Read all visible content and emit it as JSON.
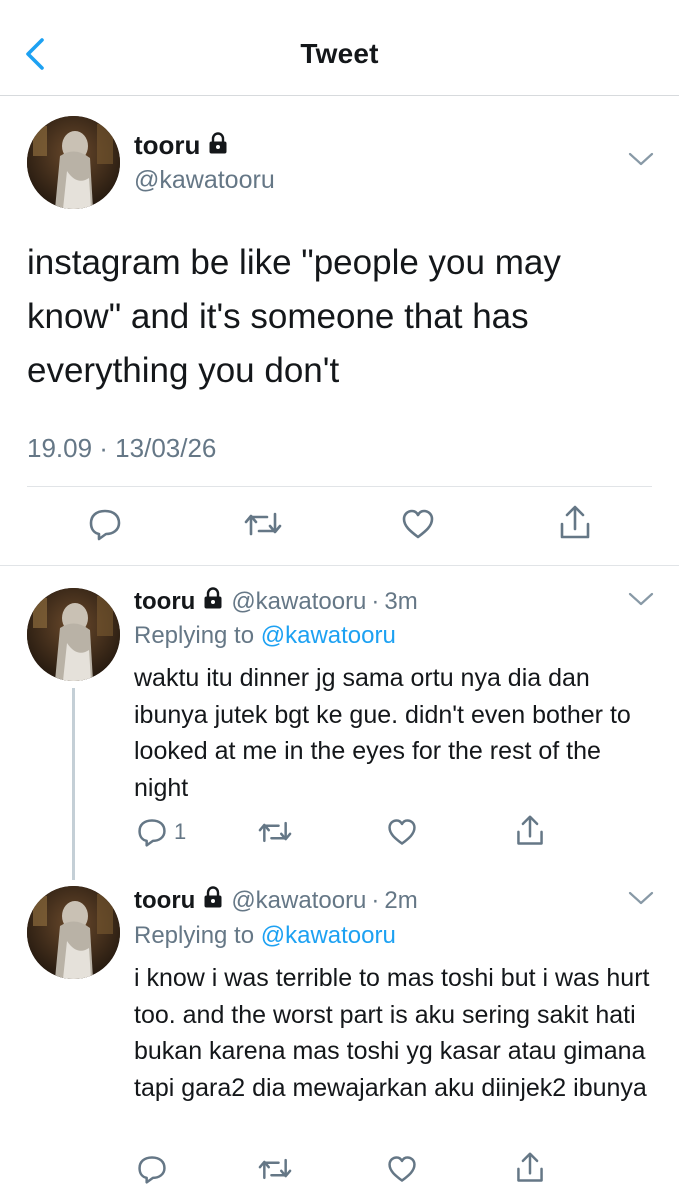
{
  "nav": {
    "title": "Tweet"
  },
  "main_tweet": {
    "name": "tooru",
    "handle": "@kawatooru",
    "text": "instagram be like \"people you may know\" and it's someone that has everything you don't",
    "timestamp": "19.09 · 13/03/26"
  },
  "replies": [
    {
      "name": "tooru",
      "handle": "@kawatooru",
      "sep": "·",
      "time": "3m",
      "replying_label": "Replying to",
      "replying_to": "@kawatooru",
      "text": "waktu itu dinner jg sama ortu nya dia dan ibunya jutek bgt ke gue. didn't even bother to looked at me in the eyes for the rest of the night",
      "reply_count": "1"
    },
    {
      "name": "tooru",
      "handle": "@kawatooru",
      "sep": "·",
      "time": "2m",
      "replying_label": "Replying to",
      "replying_to": "@kawatooru",
      "text": "i know i was terrible to mas toshi but i was hurt too. and the worst part is aku sering sakit hati bukan karena mas toshi yg kasar atau gimana tapi gara2 dia mewajarkan aku diinjek2 ibunya",
      "reply_count": ""
    }
  ],
  "colors": {
    "accent": "#1da1f2",
    "secondary_text": "#657786",
    "icon": "#657786"
  },
  "icons": [
    "back-chevron-icon",
    "lock-icon",
    "chevron-down-icon",
    "reply-icon",
    "retweet-icon",
    "like-icon",
    "share-icon"
  ]
}
